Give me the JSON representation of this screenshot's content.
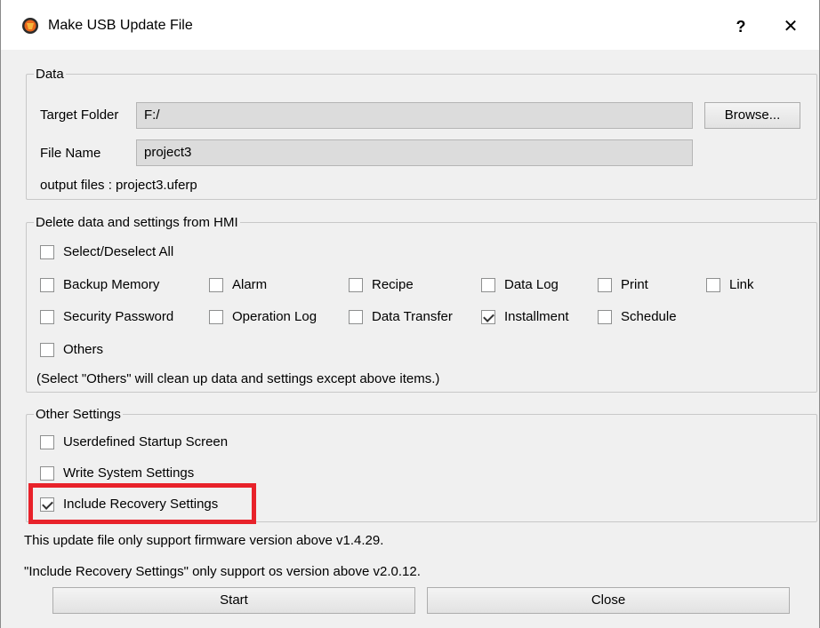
{
  "window": {
    "title": "Make USB Update File",
    "help_label": "?",
    "close_label": "✕"
  },
  "data_group": {
    "legend": "Data",
    "target_folder_label": "Target Folder",
    "target_folder_value": "F:/",
    "browse_label": "Browse...",
    "file_name_label": "File Name",
    "file_name_value": "project3",
    "output_files": "output files : project3.uferp"
  },
  "delete_group": {
    "legend": "Delete data and settings from HMI",
    "select_all": {
      "label": "Select/Deselect All",
      "checked": false
    },
    "items": [
      {
        "label": "Backup Memory",
        "checked": false
      },
      {
        "label": "Alarm",
        "checked": false
      },
      {
        "label": "Recipe",
        "checked": false
      },
      {
        "label": "Data Log",
        "checked": false
      },
      {
        "label": "Print",
        "checked": false
      },
      {
        "label": "Link",
        "checked": false
      },
      {
        "label": "Security Password",
        "checked": false
      },
      {
        "label": "Operation Log",
        "checked": false
      },
      {
        "label": "Data Transfer",
        "checked": false
      },
      {
        "label": "Installment",
        "checked": true
      },
      {
        "label": "Schedule",
        "checked": false
      },
      {
        "label": "Others",
        "checked": false
      }
    ],
    "note": "(Select \"Others\" will clean up data and settings except above items.)"
  },
  "other_group": {
    "legend": "Other Settings",
    "items": [
      {
        "label": "Userdefined Startup Screen",
        "checked": false
      },
      {
        "label": "Write System Settings",
        "checked": false
      },
      {
        "label": "Include Recovery Settings",
        "checked": true
      }
    ]
  },
  "footer": {
    "note1": "This update file only support firmware version above v1.4.29.",
    "note2": "\"Include Recovery Settings\" only support os version above v2.0.12.",
    "start_label": "Start",
    "close_label": "Close"
  },
  "colors": {
    "highlight": "#e8222a",
    "field_bg": "#dcdcdc",
    "dialog_bg": "#f0f0f0"
  }
}
